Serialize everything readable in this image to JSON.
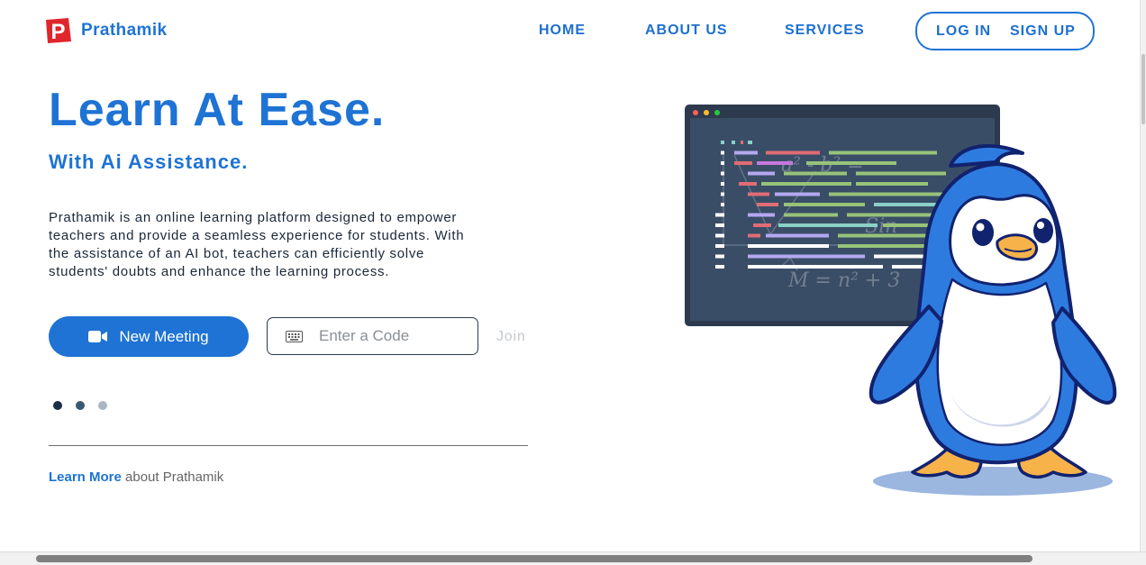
{
  "brand": {
    "name": "Prathamik",
    "logo_letter": "P",
    "color": "#1f74d6"
  },
  "nav": {
    "home": "HOME",
    "about": "ABOUT US",
    "services": "SERVICES",
    "login": "LOG IN",
    "signup": "SIGN UP"
  },
  "hero": {
    "title": "Learn At Ease.",
    "subtitle": "With Ai Assistance.",
    "description_lines": [
      "Prathamik is an online learning platform designed to empower",
      "teachers and provide a seamless experience for students. With",
      "the assistance of an AI bot, teachers can efficiently solve",
      "students' doubts and enhance the learning process."
    ]
  },
  "actions": {
    "new_meeting_label": "New Meeting",
    "new_meeting_icon": "video-camera-icon",
    "code_placeholder": "Enter a Code",
    "code_icon": "keyboard-icon",
    "join_label": "Join"
  },
  "carousel": {
    "dots": 3,
    "active_index": 0
  },
  "learn_more": {
    "link": "Learn More",
    "rest": "about Prathamik"
  },
  "illustration": {
    "monitor_formula_text": [
      "a² - b² =",
      "Sin",
      "M = n² + 3"
    ],
    "mascot": "blue-penguin"
  },
  "colors": {
    "primary": "#1e73d4",
    "text_dark": "#1b2838",
    "muted": "#666666"
  }
}
